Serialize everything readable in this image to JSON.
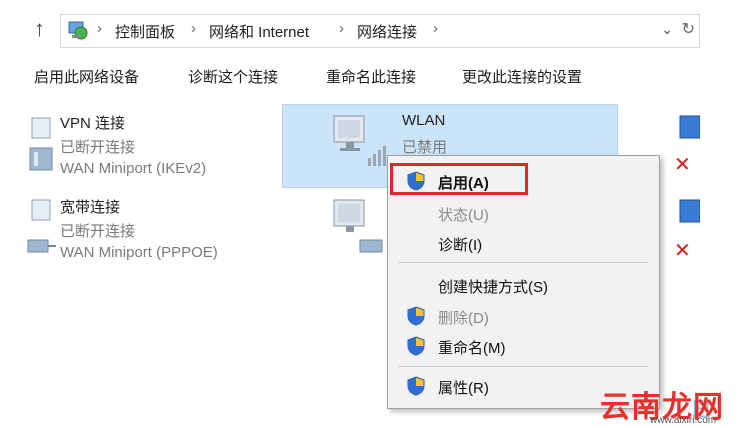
{
  "address_bar": {
    "crumbs": [
      "控制面板",
      "网络和 Internet",
      "网络连接"
    ]
  },
  "toolbar": {
    "items": [
      "启用此网络设备",
      "诊断这个连接",
      "重命名此连接",
      "更改此连接的设置"
    ]
  },
  "connections": [
    {
      "name": "VPN 连接",
      "status": "已断开连接",
      "device": "WAN Miniport (IKEv2)"
    },
    {
      "name": "宽带连接",
      "status": "已断开连接",
      "device": "WAN Miniport (PPPOE)"
    },
    {
      "name": "WLAN",
      "status": "已禁用",
      "device": ""
    }
  ],
  "context_menu": {
    "items": [
      {
        "label": "启用(A)",
        "enabled": true,
        "shield": true,
        "bold": true
      },
      {
        "label": "状态(U)",
        "enabled": false,
        "shield": false
      },
      {
        "label": "诊断(I)",
        "enabled": true,
        "shield": false
      },
      {
        "label": "创建快捷方式(S)",
        "enabled": true,
        "shield": false
      },
      {
        "label": "删除(D)",
        "enabled": false,
        "shield": true
      },
      {
        "label": "重命名(M)",
        "enabled": true,
        "shield": true
      },
      {
        "label": "属性(R)",
        "enabled": true,
        "shield": true
      }
    ]
  },
  "watermark": {
    "brand": "云南龙网",
    "url": "www.aixiri.com"
  },
  "colors": {
    "selection": "#cce4f7",
    "highlight_border": "#e0262a",
    "watermark": "#e8302b"
  }
}
